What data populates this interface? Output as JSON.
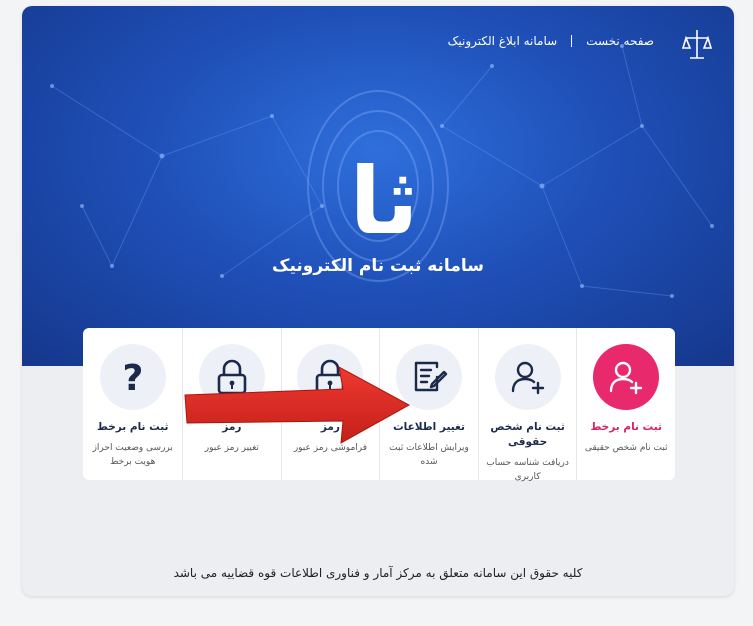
{
  "header": {
    "home_label": "صفحه نخست",
    "notice_system_label": "سامانه ابلاغ الکترونیک"
  },
  "hero": {
    "title": "سامانه ثبت نام الکترونیک",
    "mark_glyph": "ثا"
  },
  "cards": [
    {
      "title": "ثبت نام برخط",
      "desc": "ثبت نام شخص حقیقی",
      "icon": "user-plus-icon",
      "accent": "#e8296c"
    },
    {
      "title": "ثبت نام شخص حقوقی",
      "desc": "دریافت شناسه حساب کاربری",
      "icon": "user-plus-icon"
    },
    {
      "title": "تغییر اطلاعات",
      "desc": "ویرایش اطلاعات ثبت شده",
      "icon": "edit-document-icon"
    },
    {
      "title": "رمز",
      "desc": "فراموشی رمز عبور",
      "icon": "padlock-icon"
    },
    {
      "title": "رمز",
      "desc": "تغییر رمز عبور",
      "icon": "padlock-icon"
    },
    {
      "title": "ثبت نام برخط",
      "desc": "بررسی وضعیت احراز هویت برخط",
      "icon": "question-mark-icon"
    }
  ],
  "footer": {
    "copyright": "کلیه حقوق این سامانه متعلق به مرکز آمار و فناوری اطلاعات قوه قضاییه می باشد"
  },
  "colors": {
    "hero_dark": "#15378c",
    "hero_light": "#2f6fdc",
    "accent_pink": "#e8296c",
    "arrow_red": "#e02b25",
    "icon_navy": "#1b2a4a"
  }
}
